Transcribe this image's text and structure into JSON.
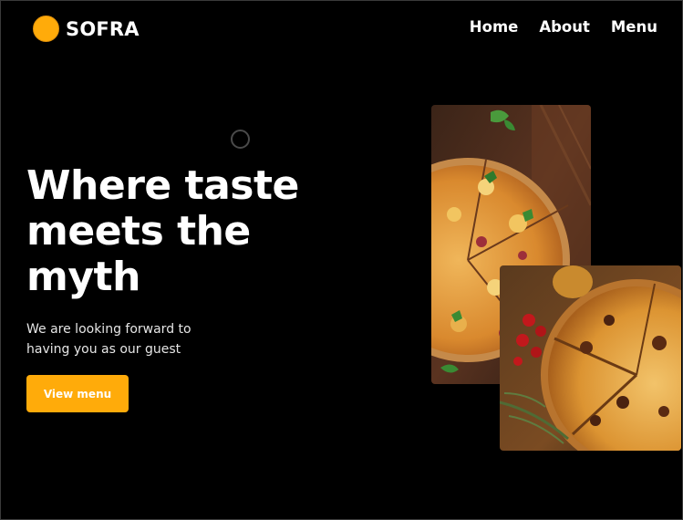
{
  "brand": {
    "name": "SOFRA",
    "accent_color": "#ffab0a"
  },
  "nav": {
    "items": [
      "Home",
      "About",
      "Menu"
    ]
  },
  "hero": {
    "title_lines": [
      "Where taste",
      "meets the",
      "myth"
    ],
    "subtitle_lines": [
      "We are looking forward to",
      "having you as our guest"
    ],
    "cta_label": "View menu"
  },
  "images": [
    {
      "name": "pizza-photo-top",
      "subject": "sliced pizza on wooden board"
    },
    {
      "name": "pizza-photo-bottom",
      "subject": "pizza with cherry tomatoes and rosemary"
    }
  ]
}
